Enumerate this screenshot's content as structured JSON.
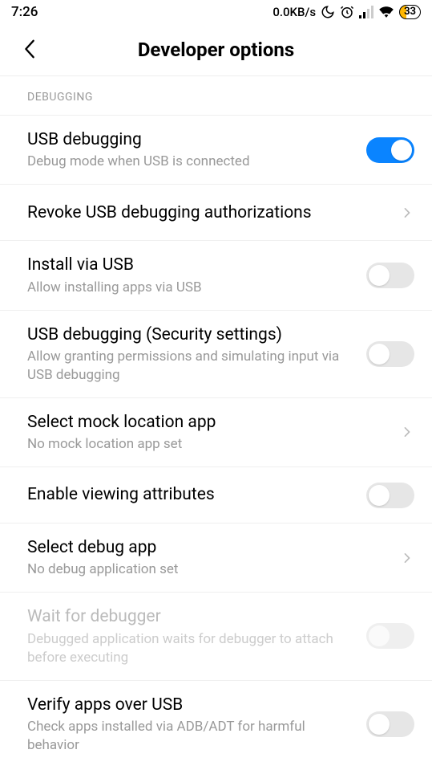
{
  "status": {
    "time": "7:26",
    "net_speed": "0.0KB/s",
    "battery": "33"
  },
  "header": {
    "title": "Developer options"
  },
  "section_label": "DEBUGGING",
  "items": {
    "usb_debugging": {
      "title": "USB debugging",
      "sub": "Debug mode when USB is connected"
    },
    "revoke": {
      "title": "Revoke USB debugging authorizations"
    },
    "install_via_usb": {
      "title": "Install via USB",
      "sub": "Allow installing apps via USB"
    },
    "usb_security": {
      "title": "USB debugging (Security settings)",
      "sub": "Allow granting permissions and simulating input via USB debugging"
    },
    "mock_location": {
      "title": "Select mock location app",
      "sub": "No mock location app set"
    },
    "viewing_attr": {
      "title": "Enable viewing attributes"
    },
    "select_debug": {
      "title": "Select debug app",
      "sub": "No debug application set"
    },
    "wait_debugger": {
      "title": "Wait for debugger",
      "sub": "Debugged application waits for debugger to attach before executing"
    },
    "verify_usb": {
      "title": "Verify apps over USB",
      "sub": "Check apps installed via ADB/ADT for harmful behavior"
    }
  }
}
